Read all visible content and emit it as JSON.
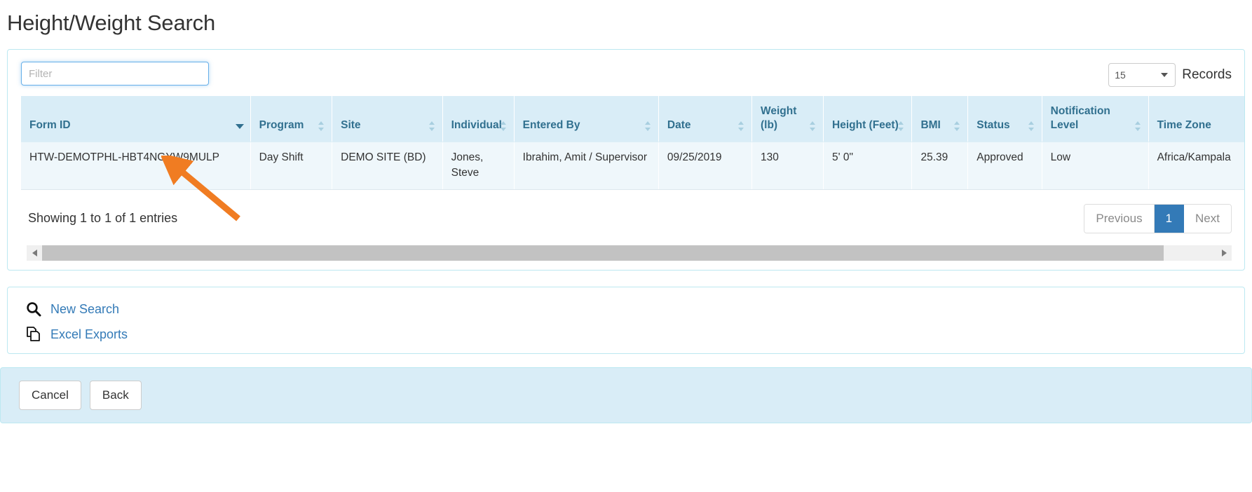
{
  "page": {
    "title": "Height/Weight Search"
  },
  "search_panel": {
    "filter": {
      "placeholder": "Filter",
      "value": ""
    },
    "records": {
      "selected": "15",
      "label": "Records"
    },
    "table": {
      "columns": [
        {
          "label": "Form ID",
          "sort": "desc"
        },
        {
          "label": "Program",
          "sort": "none"
        },
        {
          "label": "Site",
          "sort": "none"
        },
        {
          "label": "Individual",
          "sort": "none"
        },
        {
          "label": "Entered By",
          "sort": "none"
        },
        {
          "label": "Date",
          "sort": "none"
        },
        {
          "label": "Weight (lb)",
          "sort": "none"
        },
        {
          "label": "Height (Feet)",
          "sort": "none"
        },
        {
          "label": "BMI",
          "sort": "none"
        },
        {
          "label": "Status",
          "sort": "none"
        },
        {
          "label": "Notification Level",
          "sort": "none"
        },
        {
          "label": "Time Zone",
          "sort": "none"
        }
      ],
      "rows": [
        {
          "form_id": "HTW-DEMOTPHL-HBT4NGYW9MULP",
          "program": "Day Shift",
          "site": "DEMO SITE (BD)",
          "individual": "Jones, Steve",
          "entered_by": "Ibrahim, Amit / Supervisor",
          "date": "09/25/2019",
          "weight": "130",
          "height": "5' 0\"",
          "bmi": "25.39",
          "status": "Approved",
          "notification_level": "Low",
          "time_zone": "Africa/Kampala"
        }
      ]
    },
    "showing_text": "Showing 1 to 1 of 1 entries",
    "pagination": {
      "previous": "Previous",
      "pages": [
        "1"
      ],
      "next": "Next",
      "active": "1"
    }
  },
  "links_panel": {
    "items": [
      {
        "label": "New Search",
        "icon": "search-icon"
      },
      {
        "label": "Excel Exports",
        "icon": "copy-pages-icon"
      }
    ]
  },
  "action_bar": {
    "cancel": "Cancel",
    "back": "Back"
  },
  "colors": {
    "accent": "#337ab7",
    "header_bg": "#d9edf7",
    "header_text": "#31708f",
    "panel_border": "#bce8f1",
    "row_bg": "#eff7fb",
    "annotation": "#f07c22"
  }
}
